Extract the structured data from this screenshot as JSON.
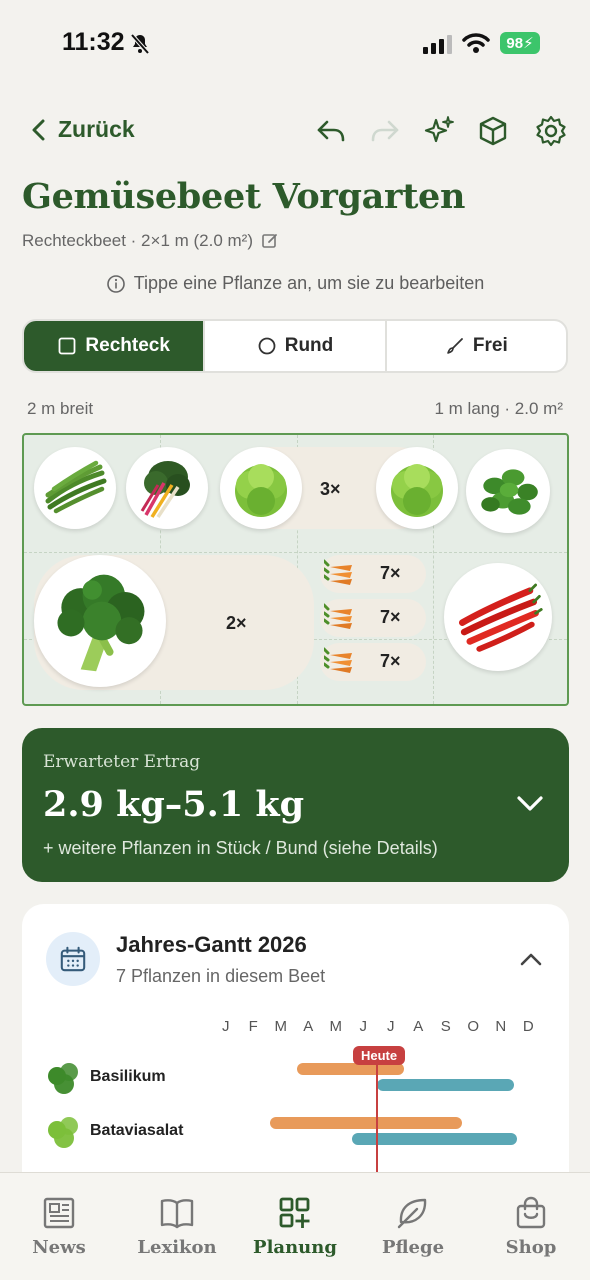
{
  "status_bar": {
    "time": "11:32",
    "battery": "98"
  },
  "nav": {
    "back_label": "Zurück"
  },
  "bed": {
    "title": "Gemüsebeet Vorgarten",
    "subtitle": "Rechteckbeet · 2×1 m (2.0 m²)",
    "hint": "Tippe eine Pflanze an, um sie zu bearbeiten",
    "width_label": "2 m breit",
    "length_label": "1 m lang · 2.0 m²",
    "shapes": [
      {
        "label": "Rechteck",
        "active": true
      },
      {
        "label": "Rund",
        "active": false
      },
      {
        "label": "Frei",
        "active": false
      }
    ],
    "plant_counts": {
      "lettuce": "3×",
      "broccoli": "2×",
      "carrot_1": "7×",
      "carrot_2": "7×",
      "carrot_3": "7×"
    }
  },
  "yield": {
    "label": "Erwarteter Ertrag",
    "value": "2.9 kg–5.1 kg",
    "note": "+ weitere Pflanzen in Stück / Bund (siehe Details)"
  },
  "gantt": {
    "title": "Jahres-Gantt 2026",
    "subtitle": "7 Pflanzen in diesem Beet",
    "months": [
      "J",
      "F",
      "M",
      "A",
      "M",
      "J",
      "J",
      "A",
      "S",
      "O",
      "N",
      "D"
    ],
    "today_label": "Heute",
    "today_month": 5.5,
    "rows": [
      {
        "name": "Basilikum",
        "sow": [
          2.6,
          6.5
        ],
        "harvest": [
          5.5,
          10.5
        ]
      },
      {
        "name": "Bataviasalat",
        "sow": [
          1.6,
          8.6
        ],
        "harvest": [
          4.6,
          10.6
        ]
      }
    ]
  },
  "tabbar": [
    {
      "label": "News",
      "icon": "newspaper-icon",
      "active": false
    },
    {
      "label": "Lexikon",
      "icon": "book-icon",
      "active": false
    },
    {
      "label": "Planung",
      "icon": "grid-plus-icon",
      "active": true
    },
    {
      "label": "Pflege",
      "icon": "leaf-icon",
      "active": false
    },
    {
      "label": "Shop",
      "icon": "bag-icon",
      "active": false
    }
  ],
  "colors": {
    "primary": "#2d5a2b",
    "bed_border": "#5e9a52",
    "orange_bar": "#e89a5a",
    "teal_bar": "#5aa7b5",
    "today": "#c74040"
  }
}
